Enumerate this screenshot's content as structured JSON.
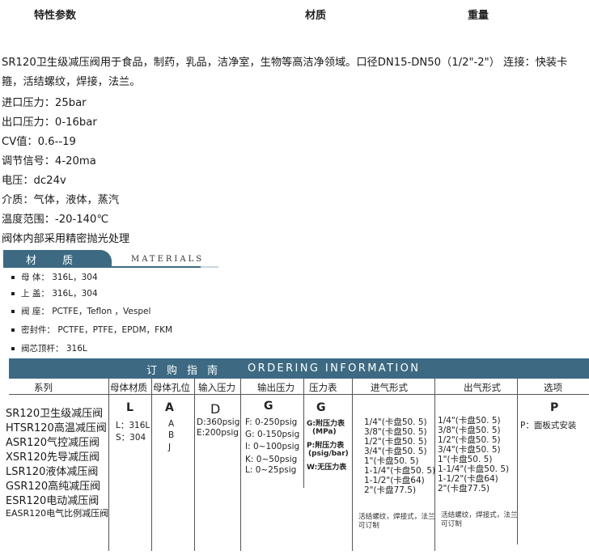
{
  "header": {
    "specs": "特性参数",
    "material": "材质",
    "weight": "重量"
  },
  "description": {
    "line1": "SR120卫生级减压阀用于食品，制药，乳品，洁净室，生物等高洁净领域。口径DN15-DN50（1/2\"-2\"） 连接：快装卡",
    "line2": "箍，活结螺纹，焊接，法兰。"
  },
  "specs": [
    "进口压力：25bar",
    "出口压力：0-16bar",
    "CV值：0.6--19",
    "调节信号：4-20ma",
    "电压：dc24v",
    "介质：气体，液体，蒸汽",
    "温度范围：-20-140℃",
    "阀体内部采用精密抛光处理"
  ],
  "materials": {
    "title": "材 质",
    "title_en": "MATERIALS",
    "items": [
      {
        "label": "母 体：",
        "value": "316L，304"
      },
      {
        "label": "上 盖：",
        "value": "316L，304"
      },
      {
        "label": "阀 座：",
        "value": "PCTFE，Teflon ，Vespel"
      },
      {
        "label": "密封件：",
        "value": "PCTFE，PTFE，EPDM，FKM"
      },
      {
        "label": "阀芯顶杆：",
        "value": "316L"
      }
    ]
  },
  "ordering": {
    "title_zh": "订购指南",
    "title_en": "ORDERING INFORMATION",
    "columns": [
      "系列",
      "母体材质",
      "母体孔位",
      "输入压力",
      "输出压力",
      "压力表",
      "进气形式",
      "出气形式",
      "选项"
    ],
    "series": [
      "SR120卫生级减压阀",
      "HTSR120高温减压阀",
      "ASR120气控减压阀",
      "XSR120先导减压阀",
      "LSR120液体减压阀",
      "GSR120高纯减压阀",
      "ESR120电动减压阀",
      "EASR120电气比例减压阀"
    ],
    "body_material": {
      "code": "L",
      "options": [
        "L：316L",
        "S：304"
      ]
    },
    "body_port": {
      "code": "A",
      "options": [
        "A",
        "B",
        "J"
      ]
    },
    "input_pressure": {
      "code": "D",
      "options": [
        "D:360psig",
        "E:200psig"
      ]
    },
    "output_pressure": {
      "code": "G",
      "options": [
        "F: 0-250psig",
        "G: 0-150psig",
        "I: 0~100psig",
        "K: 0~50psig",
        "L: 0~25psig"
      ]
    },
    "gauge": {
      "code": "G",
      "options": [
        "G:附压力表",
        "(MPa)",
        "P:附压力表",
        "(psig/bar)",
        "W:无压力表"
      ]
    },
    "inlet": {
      "options": [
        "1/4\"(卡盘50. 5)",
        "3/8\"(卡盘50. 5)",
        "1/2\"(卡盘50. 5)",
        "3/4\"(卡盘50. 5)",
        "1\"(卡盘50. 5)",
        "1-1/4\"(卡盘50. 5)",
        "1-1/2\"(卡盘64)",
        "2\"(卡盘77.5)"
      ],
      "note": "活结螺纹，焊接式，法兰可订制"
    },
    "outlet": {
      "options": [
        "1/4\"(卡盘50. 5)",
        "3/8\"(卡盘50. 5)",
        "1/2\"(卡盘50. 5)",
        "3/4\"(卡盘50. 5)",
        "1\"(卡盘50. 5)",
        "1-1/4\"(卡盘50. 5)",
        "1-1/2\"(卡盘64)",
        "2\"(卡盘77.5)"
      ],
      "note": "活结螺纹，焊接式，法兰可订制"
    },
    "option": {
      "code": "P",
      "options": [
        "P：面板式安装"
      ]
    }
  },
  "colors": {
    "banner": "#3d6a82",
    "text": "#1a1a1a"
  }
}
